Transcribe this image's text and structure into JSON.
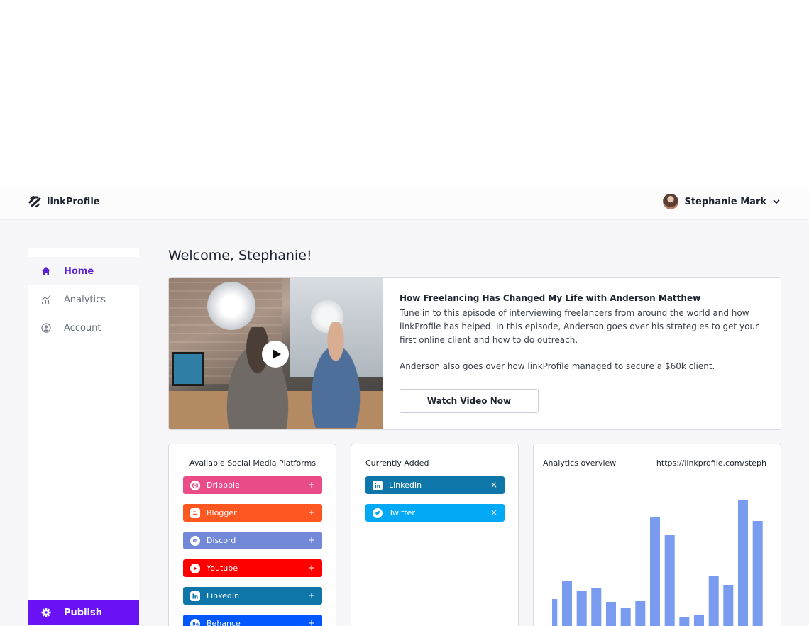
{
  "brand": {
    "name": "linkProfile"
  },
  "user": {
    "name": "Stephanie Mark"
  },
  "sidebar": {
    "items": [
      {
        "label": "Home",
        "icon": "home-icon",
        "active": true
      },
      {
        "label": "Analytics",
        "icon": "chart-icon",
        "active": false
      },
      {
        "label": "Account",
        "icon": "user-circle-icon",
        "active": false
      }
    ],
    "publish": {
      "label": "Publish",
      "icon": "gear-icon"
    }
  },
  "main": {
    "welcome": "Welcome, Stephanie!",
    "feature": {
      "title": "How Freelancing Has Changed My Life with Anderson Matthew",
      "description": "Tune in to this episode of interviewing freelancers from around the world and how linkProfile has helped. In this episode, Anderson goes over his strategies to get your first online client and how to do outreach.",
      "description2": "Anderson also goes over how linkProfile managed to secure a $60k client.",
      "button": "Watch Video Now"
    },
    "available": {
      "title": "Available Social Media Platforms",
      "items": [
        {
          "label": "Dribbble",
          "color": "#ea4c89",
          "action": "+"
        },
        {
          "label": "Blogger",
          "color": "#ff5722",
          "action": "+"
        },
        {
          "label": "Discord",
          "color": "#7289da",
          "action": "+"
        },
        {
          "label": "Youtube",
          "color": "#ff0000",
          "action": "+"
        },
        {
          "label": "LinkedIn",
          "color": "#0e76a8",
          "action": "+"
        },
        {
          "label": "Behance",
          "color": "#0057ff",
          "action": "+"
        }
      ]
    },
    "added": {
      "title": "Currently Added",
      "items": [
        {
          "label": "LinkedIn",
          "color": "#0e76a8",
          "action": "×"
        },
        {
          "label": "Twitter",
          "color": "#03a9f4",
          "action": "×"
        }
      ]
    },
    "analytics": {
      "title": "Analytics overview",
      "url": "https://linkprofile.com/steph"
    }
  },
  "chart_data": {
    "type": "bar",
    "values": [
      40,
      65,
      52,
      56,
      36,
      28,
      37,
      156,
      130,
      14,
      18,
      72,
      60,
      180,
      150
    ],
    "color": "#7a9cf0"
  }
}
